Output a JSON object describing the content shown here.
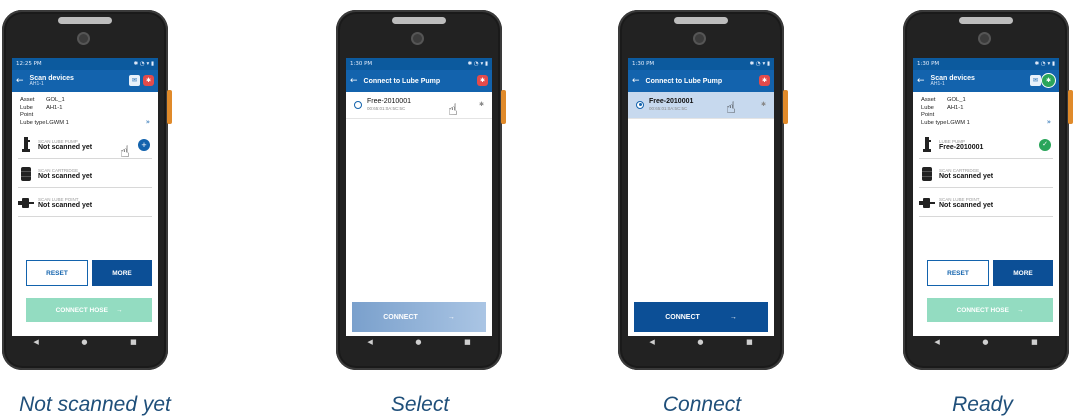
{
  "colors": {
    "brand": "#1363ad",
    "status_bar": "#0c5a9e",
    "ok": "#2aa55a",
    "alert": "#e34b4b",
    "hose": "#93dcc1",
    "caption": "#1f4f7a"
  },
  "screens": [
    {
      "caption": "Not scanned yet",
      "status_time": "12:25 PM",
      "title": "Scan devices",
      "subtitle": "AH1-1",
      "info": [
        {
          "key": "Asset",
          "value": "GOL_1"
        },
        {
          "key": "Lube Point",
          "value": "AH1-1"
        },
        {
          "key": "Lube type",
          "value": "LGWM 1"
        }
      ],
      "slots": [
        {
          "caption": "SCAN LUBE PUMP",
          "value": "Not scanned yet"
        },
        {
          "caption": "SCAN CARTRIDGE",
          "value": "Not scanned yet"
        },
        {
          "caption": "SCAN LUBE POINT",
          "value": "Not scanned yet"
        }
      ],
      "reset_label": "RESET",
      "more_label": "MORE",
      "hose_label": "CONNECT HOSE"
    },
    {
      "caption": "Select",
      "status_time": "1:30 PM",
      "title": "Connect to Lube Pump",
      "device_name": "Free-2010001",
      "device_mac": "00:65:01:0A:5C:5C",
      "connect_label": "CONNECT"
    },
    {
      "caption": "Connect",
      "status_time": "1:30 PM",
      "title": "Connect to Lube Pump",
      "device_name": "Free-2010001",
      "device_mac": "00:65:01:0A:5C:5C",
      "connect_label": "CONNECT"
    },
    {
      "caption": "Ready",
      "status_time": "1:30 PM",
      "title": "Scan devices",
      "subtitle": "AH1-1",
      "info": [
        {
          "key": "Asset",
          "value": "GOL_1"
        },
        {
          "key": "Lube Point",
          "value": "AH1-1"
        },
        {
          "key": "Lube type",
          "value": "LGWM 1"
        }
      ],
      "slots": [
        {
          "caption": "LUBE PUMP",
          "value": "Free-2010001"
        },
        {
          "caption": "SCAN CARTRIDGE",
          "value": "Not scanned yet"
        },
        {
          "caption": "SCAN LUBE POINT",
          "value": "Not scanned yet"
        }
      ],
      "reset_label": "RESET",
      "more_label": "MORE",
      "hose_label": "CONNECT HOSE"
    }
  ]
}
